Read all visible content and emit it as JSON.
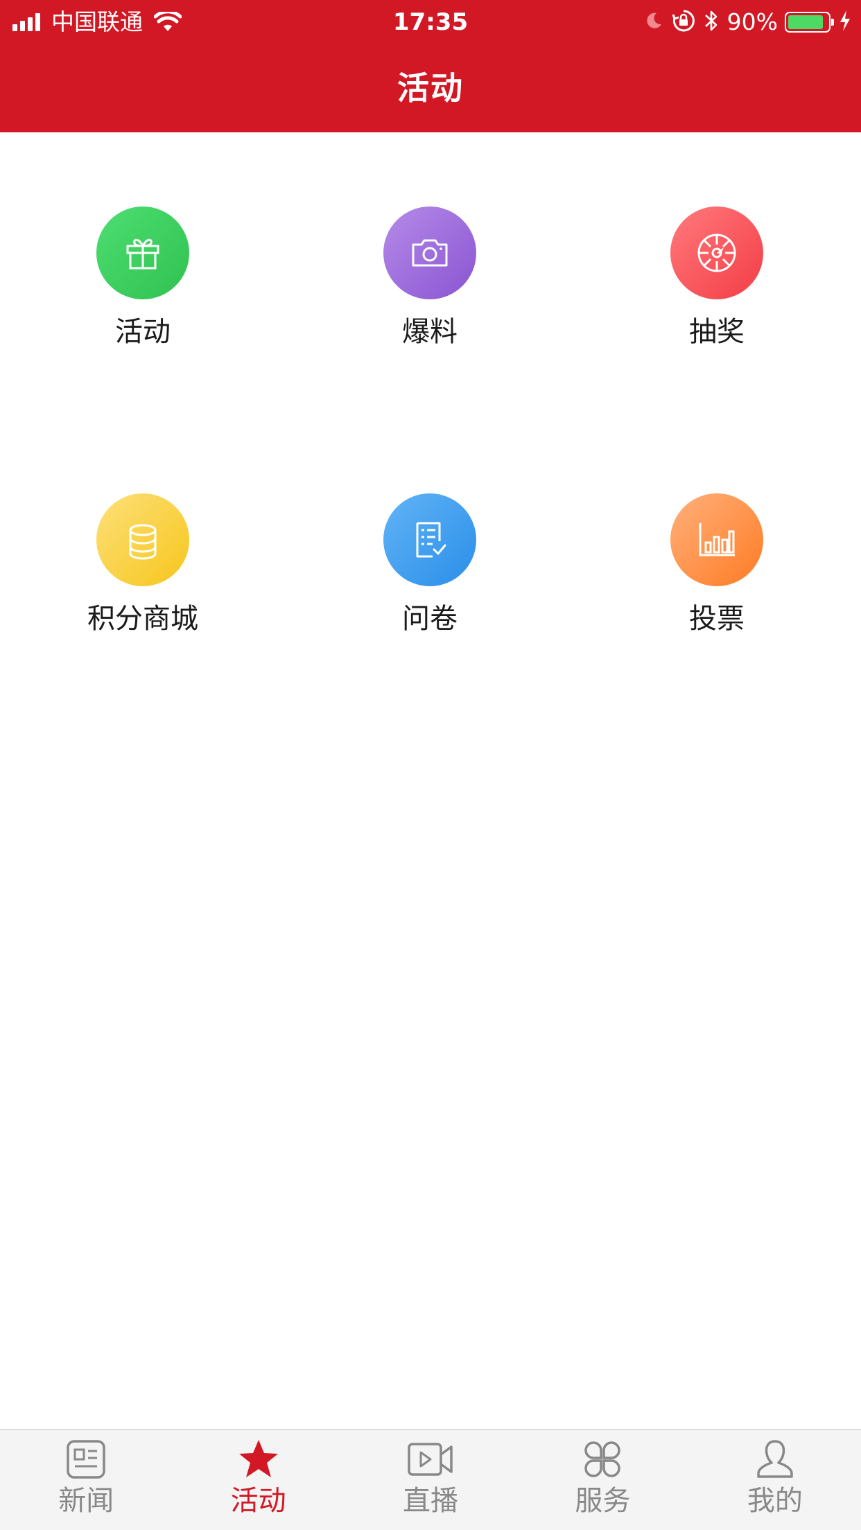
{
  "status_bar": {
    "carrier": "中国联通",
    "time": "17:35",
    "battery": "90%",
    "battery_level": 0.9
  },
  "header": {
    "title": "活动",
    "color": "#d21824"
  },
  "grid": {
    "items": [
      {
        "label": "活动",
        "icon": "gift-icon",
        "colors": [
          "#4ede72",
          "#2fc150"
        ]
      },
      {
        "label": "爆料",
        "icon": "camera-icon",
        "colors": [
          "#b58be8",
          "#8a54d2"
        ]
      },
      {
        "label": "抽奖",
        "icon": "wheel-icon",
        "colors": [
          "#ff7a7d",
          "#f43c45"
        ]
      },
      {
        "label": "积分商城",
        "icon": "coins-icon",
        "colors": [
          "#fde07a",
          "#f6c61b"
        ]
      },
      {
        "label": "问卷",
        "icon": "survey-icon",
        "colors": [
          "#62b4f6",
          "#2a8ee9"
        ]
      },
      {
        "label": "投票",
        "icon": "chart-icon",
        "colors": [
          "#ffb07b",
          "#ff7b24"
        ]
      }
    ]
  },
  "tabbar": {
    "tabs": [
      {
        "label": "新闻",
        "icon": "news-icon"
      },
      {
        "label": "活动",
        "icon": "star-icon"
      },
      {
        "label": "直播",
        "icon": "video-icon"
      },
      {
        "label": "服务",
        "icon": "clover-icon"
      },
      {
        "label": "我的",
        "icon": "person-icon"
      }
    ],
    "active_index": 1,
    "active_color": "#d21824",
    "inactive_color": "#888888"
  }
}
